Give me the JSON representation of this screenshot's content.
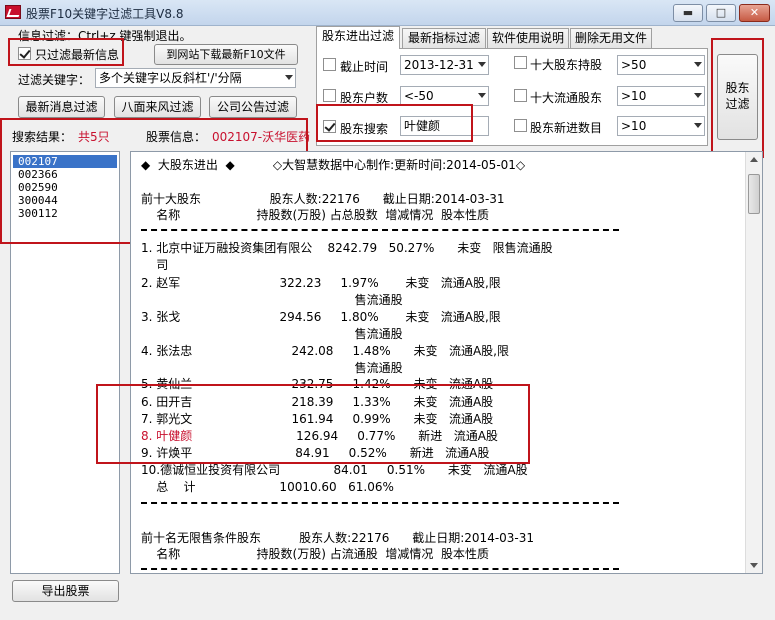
{
  "window": {
    "title": "股票F10关键字过滤工具V8.8",
    "minimize": "▬",
    "maximize": "□",
    "close": "✕"
  },
  "left_panel": {
    "info_filter_text": "信息过滤：Ctrl+z 键强制退出。",
    "only_latest_checkbox": {
      "label": "只过滤最新信息",
      "checked": true
    },
    "download_button": "到网站下载最新F10文件",
    "keyword_label": "过滤关键字：",
    "keyword_value": "多个关键字以反斜杠'/'分隔",
    "latest_news_button": "最新消息过滤",
    "bamian_button": "八面来风过滤",
    "announcement_button": "公司公告过滤",
    "search_result_label": "搜索结果：",
    "search_result_count": "共5只",
    "stock_info_label": "股票信息：",
    "stock_info_value": "002107-沃华医药",
    "export_button": "导出股票"
  },
  "stock_list": [
    "002107",
    "002366",
    "002590",
    "300044",
    "300112"
  ],
  "tabs": [
    "股东进出过滤",
    "最新指标过滤",
    "软件使用说明",
    "删除无用文件"
  ],
  "active_tab": "股东进出过滤",
  "filter_panel": {
    "cutoff_time": {
      "label": "截止时间",
      "checked": false,
      "value": "2013-12-31"
    },
    "shareholder_count": {
      "label": "股东户数",
      "checked": false,
      "value": "<-50"
    },
    "shareholder_search": {
      "label": "股东搜索",
      "checked": true,
      "value": "叶健颜"
    },
    "top10_holding": {
      "label": "十大股东持股",
      "checked": false,
      "value": ">50"
    },
    "top10_float": {
      "label": "十大流通股东",
      "checked": false,
      "value": ">10"
    },
    "new_holders": {
      "label": "股东新进数目",
      "checked": false,
      "value": ">10"
    },
    "filter_button": "股东\n过滤"
  },
  "content": {
    "header": "◆  大股东进出  ◆          ◇大智慧数据中心制作:更新时间:2014-05-01◇",
    "section1_title": "前十大股东                  股东人数:22176      截止日期:2014-03-31",
    "section1_cols": "    名称                    持股数(万股) 占总股数  增减情况  股本性质",
    "rows1": [
      "1. 北京中证万融投资集团有限公    8242.79   50.27%      未变   限售流通股",
      "    司",
      "2. 赵军                          322.23     1.97%       未变   流通A股,限",
      "                                                        售流通股",
      "3. 张戈                          294.56     1.80%       未变   流通A股,限",
      "                                                        售流通股",
      "4. 张法忠                          242.08     1.48%      未变   流通A股,限",
      "                                                        售流通股",
      "5. 黄仙兰                          232.75     1.42%      未变   流通A股",
      "6. 田开吉                          218.39     1.33%      未变   流通A股",
      "7. 郭光文                          161.94     0.99%      未变   流通A股"
    ],
    "row8_highlight": "8. 叶健颜",
    "row8_rest": "                          126.94     0.77%      新进   流通A股",
    "rows2": [
      "9. 许焕平                           84.91     0.52%      新进   流通A股",
      "10.德诚恒业投资有限公司              84.01     0.51%      未变   流通A股",
      "    总    计                      10010.60   61.06%"
    ],
    "section2_title": "前十名无限售条件股东          股东人数:22176      截止日期:2014-03-31",
    "section2_cols": "    名称                    持股数(万股) 占流通股  增减情况  股本性质"
  }
}
